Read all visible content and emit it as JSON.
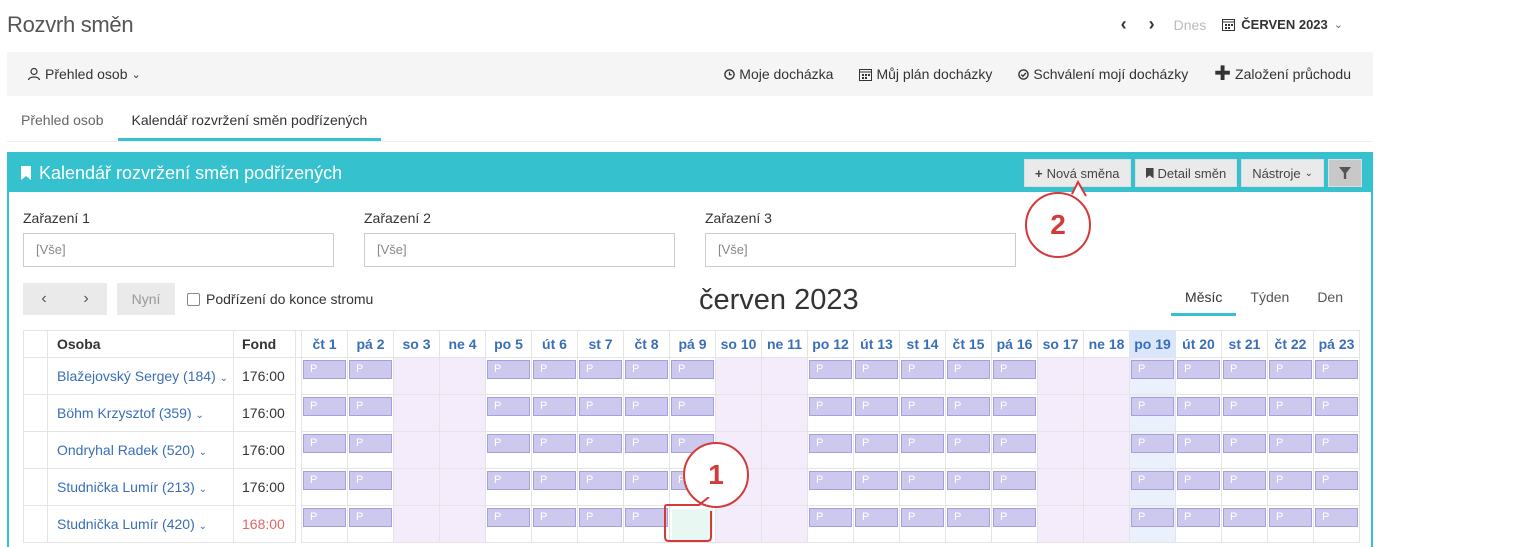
{
  "page": {
    "title": "Rozvrh směn"
  },
  "topnav": {
    "prev": "‹",
    "next": "›",
    "today": "Dnes",
    "month": "ČERVEN 2023"
  },
  "toolbar": {
    "people_label": "Přehled osob",
    "items": [
      {
        "label": "Moje docházka",
        "icon": "clock-icon"
      },
      {
        "label": "Můj plán docházky",
        "icon": "calendar-icon"
      },
      {
        "label": "Schválení mojí docházky",
        "icon": "check-circle-icon"
      },
      {
        "label": "Založení průchodu",
        "icon": "plus-icon"
      }
    ]
  },
  "tabs": [
    {
      "label": "Přehled osob",
      "active": false
    },
    {
      "label": "Kalendář rozvržení směn podřízených",
      "active": true
    }
  ],
  "panel": {
    "title": "Kalendář rozvržení směn podřízených",
    "buttons": {
      "new_shift": "Nová směna",
      "detail": "Detail směn",
      "tools": "Nástroje"
    }
  },
  "filters": [
    {
      "label": "Zařazení 1",
      "value": "[Vše]"
    },
    {
      "label": "Zařazení 2",
      "value": "[Vše]"
    },
    {
      "label": "Zařazení 3",
      "value": "[Vše]"
    }
  ],
  "calendar": {
    "now_label": "Nyní",
    "checkbox_label": "Podřízení do konce stromu",
    "title": "červen 2023",
    "views": [
      "Měsíc",
      "Týden",
      "Den"
    ],
    "active_view": "Měsíc",
    "col_person": "Osoba",
    "col_fond": "Fond",
    "days": [
      "čt 1",
      "pá 2",
      "so 3",
      "ne 4",
      "po 5",
      "út 6",
      "st 7",
      "čt 8",
      "pá 9",
      "so 10",
      "ne 11",
      "po 12",
      "út 13",
      "st 14",
      "čt 15",
      "pá 16",
      "so 17",
      "ne 18",
      "po 19",
      "út 20",
      "st 21",
      "čt 22",
      "pá 23"
    ],
    "weekend_days": [
      "so 3",
      "ne 4",
      "so 10",
      "ne 11",
      "so 17",
      "ne 18"
    ],
    "today": "po 19",
    "shift_label": "P",
    "rows": [
      {
        "name": "Blažejovský Sergey (184)",
        "fond": "176:00",
        "warn": false,
        "missing": []
      },
      {
        "name": "Böhm Krzysztof (359)",
        "fond": "176:00",
        "warn": false,
        "missing": []
      },
      {
        "name": "Ondryhal Radek (520)",
        "fond": "176:00",
        "warn": false,
        "missing": []
      },
      {
        "name": "Studnička Lumír (213)",
        "fond": "176:00",
        "warn": false,
        "missing": []
      },
      {
        "name": "Studnička Lumír (420)",
        "fond": "168:00",
        "warn": true,
        "missing": [
          "pá 9"
        ]
      }
    ]
  },
  "callouts": [
    "1",
    "2"
  ]
}
